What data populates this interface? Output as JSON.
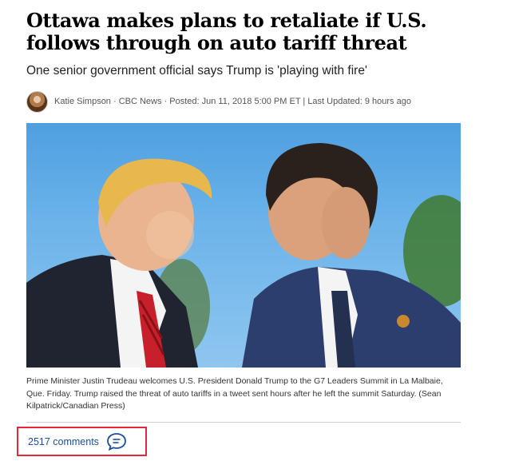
{
  "article": {
    "headline": "Ottawa makes plans to retaliate if U.S. follows through on auto tariff threat",
    "subheadline": "One senior government official says Trump is 'playing with fire'",
    "byline": "Katie Simpson · CBC News · Posted: Jun 11, 2018 5:00 PM ET | Last Updated: 9 hours ago",
    "caption": "Prime Minister Justin Trudeau welcomes U.S. President Donald Trump to the G7 Leaders Summit in La Malbaie, Que. Friday. Trump raised the threat of auto tariffs in a tweet sent hours after he left the summit Saturday. (Sean Kilpatrick/Canadian Press)"
  },
  "comments": {
    "label": "2517 comments",
    "icon": "speech-bubble-icon"
  },
  "colors": {
    "highlight_border": "#e8283a",
    "link": "#1a4f9c",
    "sky": "#6bb3ea"
  }
}
